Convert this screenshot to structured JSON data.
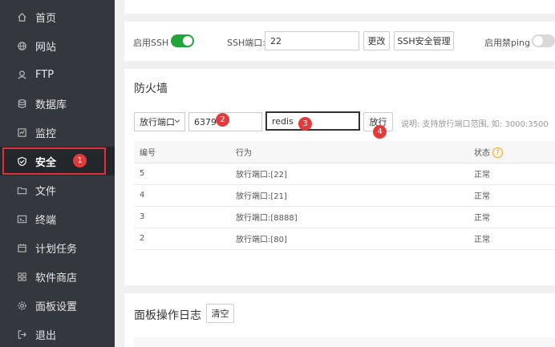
{
  "sidebar": {
    "items": [
      {
        "label": "首页",
        "icon": "home-icon"
      },
      {
        "label": "网站",
        "icon": "globe-icon"
      },
      {
        "label": "FTP",
        "icon": "ftp-icon"
      },
      {
        "label": "数据库",
        "icon": "database-icon"
      },
      {
        "label": "监控",
        "icon": "monitor-icon"
      },
      {
        "label": "安全",
        "icon": "shield-icon",
        "active": true
      },
      {
        "label": "文件",
        "icon": "folder-icon"
      },
      {
        "label": "终端",
        "icon": "terminal-icon"
      },
      {
        "label": "计划任务",
        "icon": "calendar-icon"
      },
      {
        "label": "软件商店",
        "icon": "grid-icon"
      },
      {
        "label": "面板设置",
        "icon": "gear-icon"
      },
      {
        "label": "退出",
        "icon": "logout-icon"
      }
    ]
  },
  "ssh": {
    "enable_label": "启用SSH",
    "port_label": "SSH端口:",
    "port_value": "22",
    "change_button": "更改",
    "manage_button": "SSH安全管理",
    "ping_label": "启用禁ping"
  },
  "firewall": {
    "title": "防火墙",
    "mode_selected": "放行端口",
    "port_value": "6379",
    "note_value": "redis",
    "allow_button": "放行",
    "hint": "说明: 支持放行端口范围, 如: 3000:3500",
    "columns": [
      "编号",
      "行为",
      "状态"
    ],
    "rows": [
      {
        "id": "5",
        "action": "放行端口:[22]",
        "status": "正常"
      },
      {
        "id": "4",
        "action": "放行端口:[21]",
        "status": "正常"
      },
      {
        "id": "3",
        "action": "放行端口:[8888]",
        "status": "正常"
      },
      {
        "id": "2",
        "action": "放行端口:[80]",
        "status": "正常"
      }
    ]
  },
  "log": {
    "title": "面板操作日志",
    "clear_button": "清空"
  },
  "annotations": [
    "1",
    "2",
    "3",
    "4"
  ],
  "colors": {
    "sidebar_bg": "#33383f",
    "sidebar_active": "#23272c",
    "toggle_on": "#20a53a",
    "marker_red": "#e33a3a",
    "help_orange": "#f0a020"
  }
}
